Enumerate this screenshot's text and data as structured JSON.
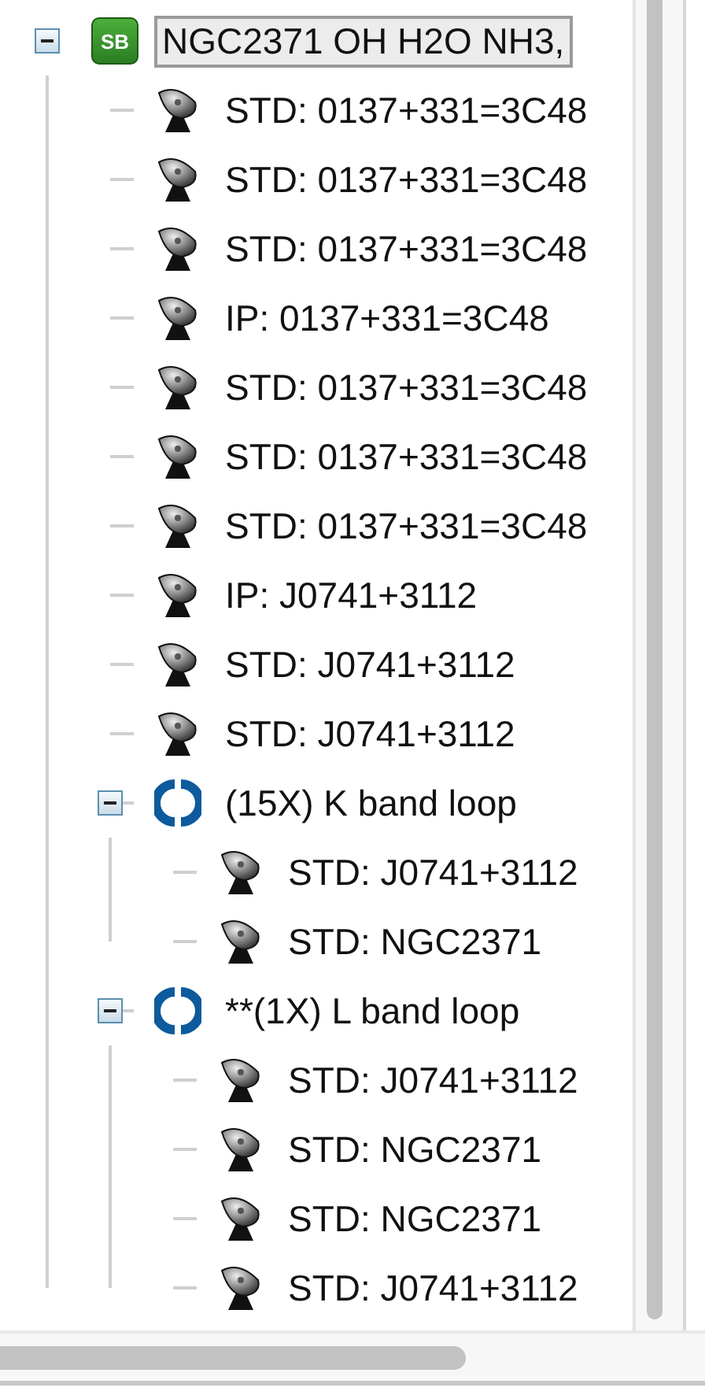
{
  "tree": [
    {
      "kind": "scheduling-block",
      "badge": "SB",
      "label": "NGC2371 OH H2O NH3,",
      "selected": true,
      "expanded": true,
      "children": [
        {
          "kind": "scan",
          "label": "STD: 0137+331=3C48",
          "selected": false
        },
        {
          "kind": "scan",
          "label": "STD: 0137+331=3C48",
          "selected": false
        },
        {
          "kind": "scan",
          "label": "STD: 0137+331=3C48",
          "selected": false
        },
        {
          "kind": "scan",
          "label": "IP: 0137+331=3C48",
          "selected": false
        },
        {
          "kind": "scan",
          "label": "STD: 0137+331=3C48",
          "selected": false
        },
        {
          "kind": "scan",
          "label": "STD: 0137+331=3C48",
          "selected": false
        },
        {
          "kind": "scan",
          "label": "STD: 0137+331=3C48",
          "selected": false
        },
        {
          "kind": "scan",
          "label": "IP: J0741+3112",
          "selected": false
        },
        {
          "kind": "scan",
          "label": "STD: J0741+3112",
          "selected": false
        },
        {
          "kind": "scan",
          "label": "STD: J0741+3112",
          "selected": false
        },
        {
          "kind": "loop",
          "label": "(15X) K band loop",
          "selected": false,
          "expanded": true,
          "children": [
            {
              "kind": "scan",
              "label": "STD: J0741+3112",
              "selected": false
            },
            {
              "kind": "scan",
              "label": "STD: NGC2371",
              "selected": false
            }
          ]
        },
        {
          "kind": "loop",
          "label": "**(1X) L band loop",
          "selected": false,
          "expanded": true,
          "children": [
            {
              "kind": "scan",
              "label": "STD: J0741+3112",
              "selected": false
            },
            {
              "kind": "scan",
              "label": "STD: NGC2371",
              "selected": false
            },
            {
              "kind": "scan",
              "label": "STD: NGC2371",
              "selected": false
            },
            {
              "kind": "scan",
              "label": "STD: J0741+3112",
              "selected": false
            }
          ]
        }
      ]
    }
  ]
}
